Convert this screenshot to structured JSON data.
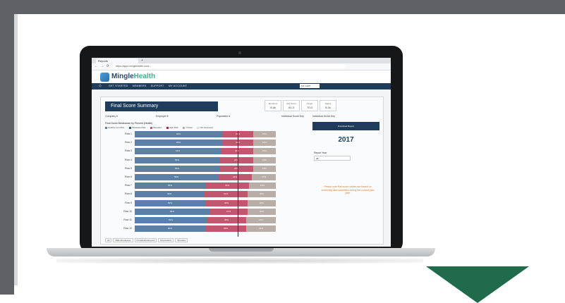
{
  "colors": {
    "frame": "#5e6266",
    "arrow": "#1f6b4c",
    "navy": "#1f3d5a",
    "bar_blue": "#5b7fa6",
    "bar_pink": "#c2566f",
    "bar_tan": "#b9aea5",
    "warning": "#e07b2a"
  },
  "browser": {
    "tab_title": "Reports",
    "new_tab": "+",
    "nav_buttons": "←  →  ⟳",
    "url": "https://apps.minglehealth.com/..."
  },
  "app": {
    "brand_name": "Mingle",
    "brand_accent": "Health",
    "home_icon": "home-icon",
    "nav_items": [
      "GET STARTED",
      "MEMBERS",
      "SUPPORT",
      "MY ACCOUNT"
    ],
    "account_select": "MY CART"
  },
  "dashboard": {
    "title": "Final Score Summary",
    "kpis": [
      {
        "label": "Members",
        "value": "8.4k"
      },
      {
        "label": "Avg Score",
        "value": "61.3"
      },
      {
        "label": "Target",
        "value": "70.0"
      },
      {
        "label": "Status",
        "value": "8.1k"
      }
    ],
    "filters": [
      "Company ▾",
      "Employer ▾",
      "Population ▾",
      "Individual Score Key"
    ],
    "chart_title": "Final Score Breakdown by Percent (Health)",
    "legend": [
      "Healthy Low Risk",
      "Moderate Risk",
      "Elevated",
      "High Risk",
      "Critical",
      "Not Assessed"
    ],
    "x_tabs": [
      "All",
      "Male Employees",
      "Female Employees",
      "Dependents",
      "Spouses"
    ]
  },
  "chart_data": {
    "type": "bar",
    "orientation": "horizontal-stacked-100",
    "categories": [
      "Row 1",
      "Row 2",
      "Row 3",
      "Row 4",
      "Row 5",
      "Row 6",
      "Row 7",
      "Row 8",
      "Row 9",
      "Row 10",
      "Row 11",
      "Row 12"
    ],
    "series": [
      {
        "values": [
          62,
          62,
          61,
          60,
          60,
          59,
          50,
          49,
          50,
          53,
          51,
          50
        ],
        "color": "#5b7fa6"
      },
      {
        "values": [
          22,
          22,
          23,
          24,
          24,
          24,
          31,
          31,
          30,
          27,
          28,
          29
        ],
        "color": "#c2566f"
      },
      {
        "values": [
          16,
          16,
          16,
          16,
          16,
          17,
          19,
          20,
          20,
          20,
          21,
          21
        ],
        "color": "#b9aea5"
      }
    ],
    "xlim": [
      0,
      100
    ]
  },
  "side": {
    "heading": "Individual Score Key",
    "button": "Download Report",
    "year": "2017",
    "label": "Report Year",
    "dropdown": "All",
    "warning": "Please note that score values are based on screening data submitted during the current plan year."
  }
}
